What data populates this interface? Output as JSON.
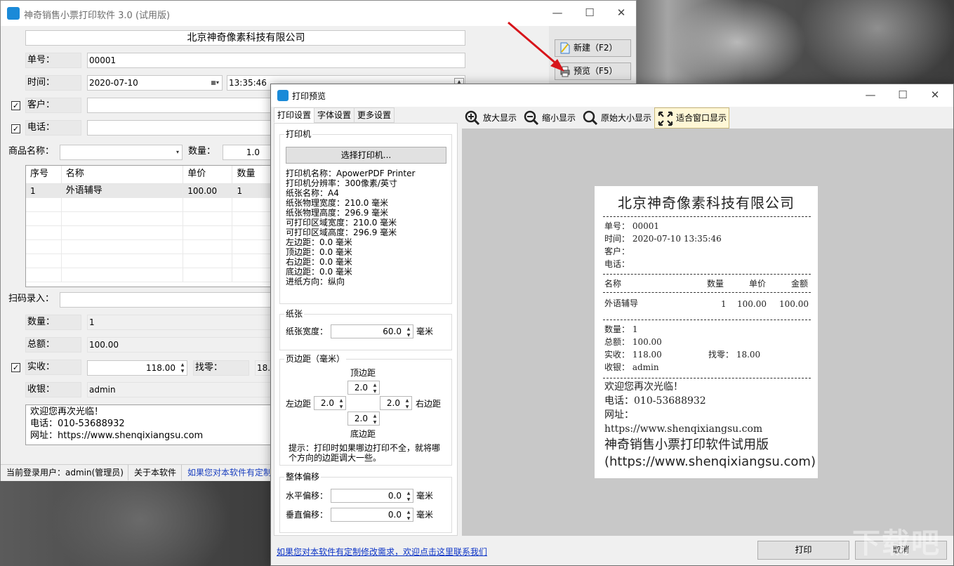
{
  "main": {
    "title": "神奇销售小票打印软件 3.0 (试用版)",
    "company": "北京神奇像素科技有限公司",
    "labels": {
      "order_no": "单号：",
      "time": "时间：",
      "customer": "客户：",
      "phone": "电话：",
      "product_name": "商品名称：",
      "quantity": "数量：",
      "scan": "扫码录入：",
      "qty_total": "数量：",
      "amount": "总额：",
      "received": "实收：",
      "change": "找零：",
      "cashier": "收银："
    },
    "values": {
      "order_no": "00001",
      "date": "2020-07-10",
      "time": "13:35:46",
      "quantity": "1.0",
      "qty_total": "1",
      "amount": "100.00",
      "received": "118.00",
      "change": "18.",
      "cashier": "admin"
    },
    "checks": {
      "customer": "✓",
      "phone": "✓",
      "received": "✓"
    },
    "buttons": {
      "new": "新建（F2）",
      "preview": "预览（F5）"
    },
    "table": {
      "headers": [
        "序号",
        "名称",
        "单价",
        "数量"
      ],
      "rows": [
        {
          "no": "1",
          "name": "外语辅导",
          "price": "100.00",
          "qty": "1"
        }
      ]
    },
    "memo_lines": [
      "欢迎您再次光临！",
      "电话：010-53688932",
      "网址：https://www.shenqixiangsu.com"
    ],
    "status": {
      "user": "当前登录用户：admin(管理员)",
      "about": "关于本软件",
      "custom": "如果您对本软件有定制"
    }
  },
  "preview": {
    "title": "打印预览",
    "tabs": [
      "打印设置",
      "字体设置",
      "更多设置"
    ],
    "printer_group": "打印机",
    "select_printer": "选择打印机...",
    "printer_info": [
      "打印机名称：ApowerPDF Printer",
      "打印机分辨率：300像素/英寸",
      "纸张名称：A4",
      "纸张物理宽度：210.0 毫米",
      "纸张物理高度：296.9 毫米",
      "可打印区域宽度：210.0 毫米",
      "可打印区域高度：296.9 毫米",
      "左边距：0.0 毫米",
      "顶边距：0.0 毫米",
      "右边距：0.0 毫米",
      "底边距：0.0 毫米",
      "进纸方向：纵向"
    ],
    "paper_group": "纸张",
    "paper_width_label": "纸张宽度：",
    "paper_width": "60.0",
    "unit_mm": "毫米",
    "margin_group": "页边距（毫米）",
    "margin_top_label": "顶边距",
    "margin_left_label": "左边距",
    "margin_right_label": "右边距",
    "margin_bottom_label": "底边距",
    "margin_top": "2.0",
    "margin_left": "2.0",
    "margin_right": "2.0",
    "margin_bottom": "2.0",
    "hint": "提示：打印时如果哪边打印不全，就将哪个方向的边距调大一些。",
    "offset_group": "整体偏移",
    "h_offset_label": "水平偏移：",
    "v_offset_label": "垂直偏移：",
    "h_offset": "0.0",
    "v_offset": "0.0",
    "toolbar": {
      "zoom_in": "放大显示",
      "zoom_out": "缩小显示",
      "original": "原始大小显示",
      "fit": "适合窗口显示"
    },
    "bottom_link": "如果您对本软件有定制修改需求，欢迎点击这里联系我们",
    "print_button": "打印",
    "cancel_button": "取消"
  },
  "receipt": {
    "title": "北京神奇像素科技有限公司",
    "order_line": "单号：  00001",
    "time_line": "时间：  2020-07-10 13:35:46",
    "customer_line": "客户：",
    "phone_line": "电话：",
    "headers": {
      "name": "名称",
      "qty": "数量",
      "price": "单价",
      "amount": "金额"
    },
    "item": {
      "name": "外语辅导",
      "qty": "1",
      "price": "100.00",
      "amount": "100.00"
    },
    "qty_line": "数量：  1",
    "total_line": "总额：  100.00",
    "received_line": "实收：  118.00",
    "change_line": "找零：  18.00",
    "cashier_line": "收银：  admin",
    "footer1": "欢迎您再次光临！",
    "footer2": "电话：010-53688932",
    "footer3": "网址：",
    "footer4": "https://www.shenqixiangsu.com",
    "trial1": "神奇销售小票打印软件试用版",
    "trial2": "(https://www.shenqixiangsu.com)"
  },
  "watermark": "下载吧",
  "colors": {
    "accent": "#1a8ad8",
    "link": "#0b33c6",
    "arrow": "#d7141a",
    "fit_btn_bg": "#fff7d6"
  }
}
